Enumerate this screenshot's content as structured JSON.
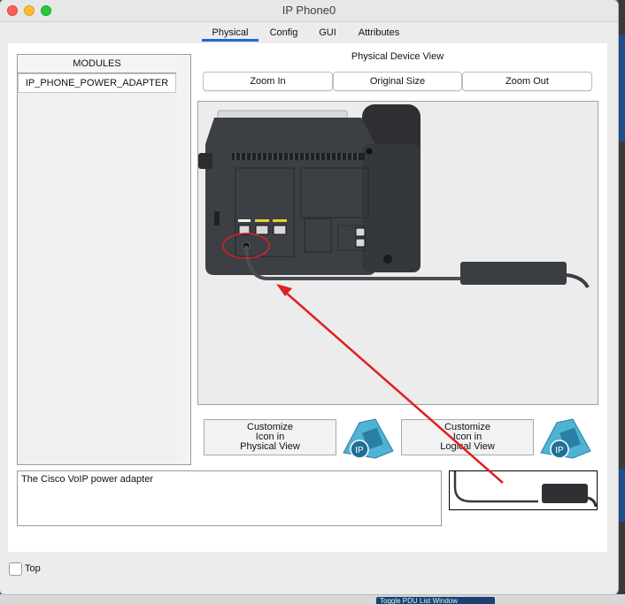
{
  "window": {
    "title": "IP Phone0"
  },
  "tabs": [
    {
      "label": "Physical",
      "active": true
    },
    {
      "label": "Config",
      "active": false
    },
    {
      "label": "GUI",
      "active": false
    },
    {
      "label": "Attributes",
      "active": false
    }
  ],
  "modules": {
    "header": "MODULES",
    "items": [
      "IP_PHONE_POWER_ADAPTER"
    ]
  },
  "physical_view": {
    "label": "Physical Device View",
    "zoom_in": "Zoom In",
    "original_size": "Original Size",
    "zoom_out": "Zoom Out"
  },
  "customize": {
    "physical_label": "Customize\nIcon in\nPhysical View",
    "logical_label": "Customize\nIcon in\nLogical View",
    "ip_badge": "IP"
  },
  "description": "The Cisco VoIP power adapter",
  "top_checkbox": {
    "label": "Top",
    "checked": false
  },
  "taskbar": {
    "item": "Toggle PDU List Window"
  },
  "colors": {
    "accent": "#2366d1",
    "annotation": "#e02020",
    "phone_body": "#3b3e42"
  }
}
